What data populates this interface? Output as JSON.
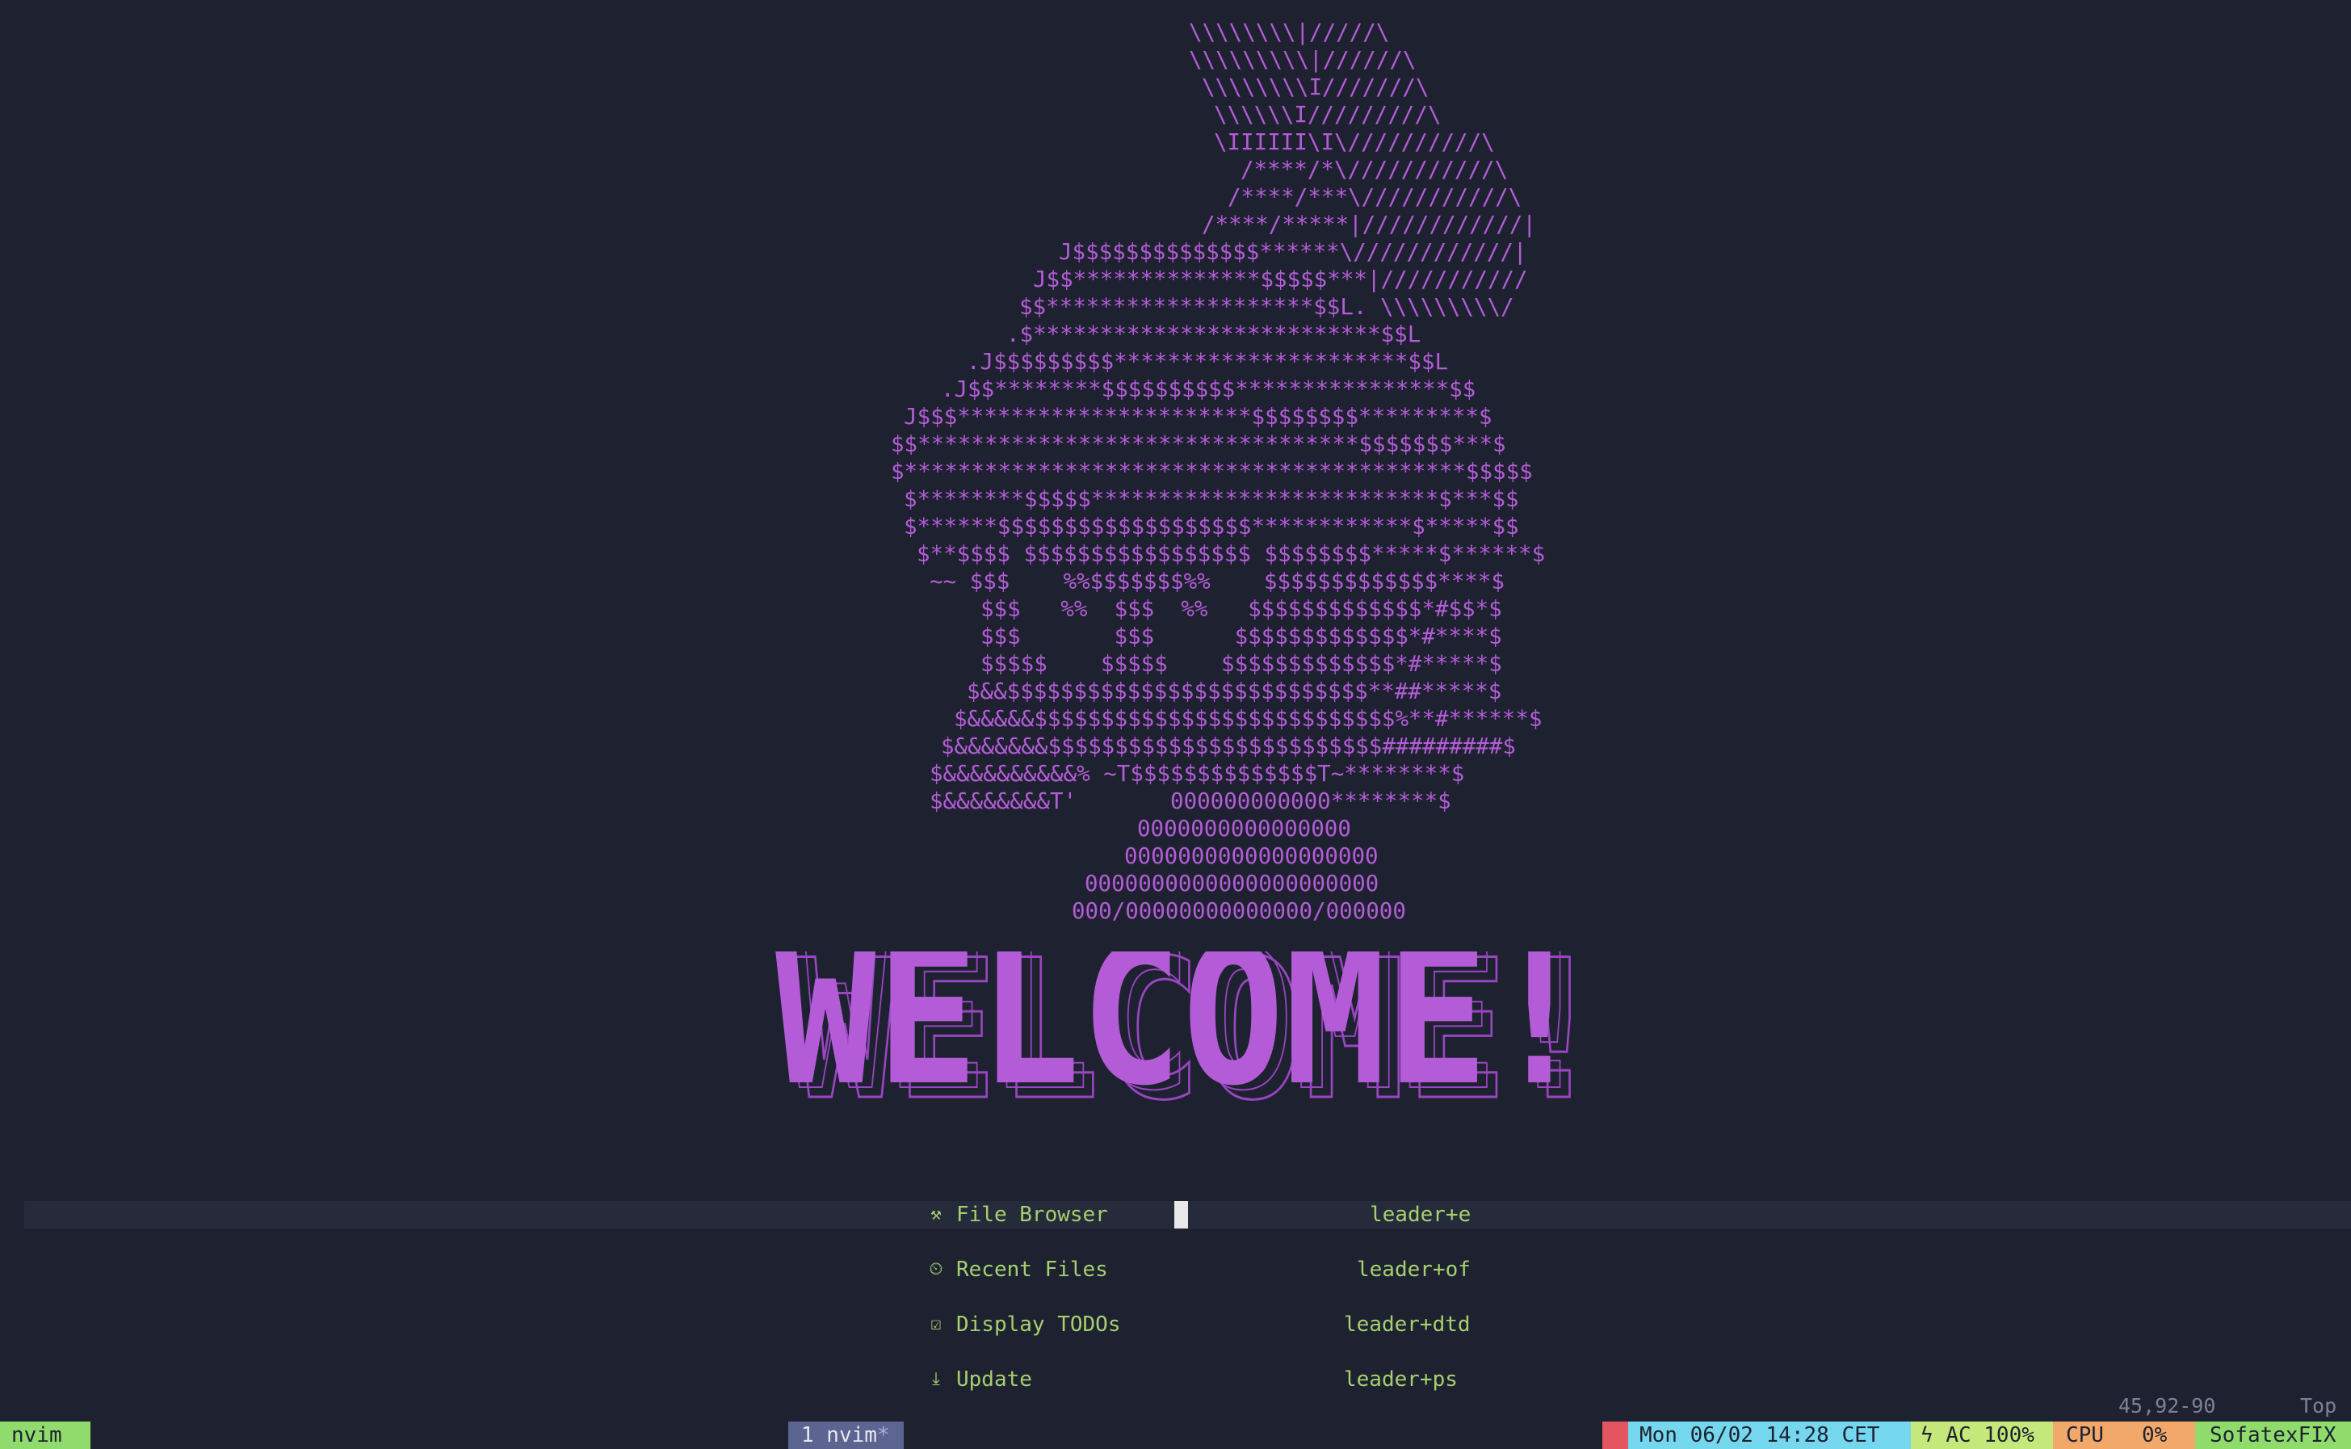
{
  "ascii_art": {
    "color": "#b45cd8",
    "lines": [
      "\\\\\\\\\\\\\\\\|/////\\",
      "\\\\\\\\\\\\\\\\\\|//////\\",
      "\\\\\\\\\\\\\\\\I///////\\",
      "\\\\\\\\\\\\I/////////\\",
      "\\IIIIII\\I\\//////////\\",
      "/****/*\\///////////\\",
      "/****/***\\///////////\\",
      "/****/*****|////////////|",
      "J$$$$$$$$$$$$$$******\\////////////|",
      "J$$**************$$$$$***|///////////",
      "$$********************$$L. \\\\\\\\\\\\\\\\\\/",
      ".$**************************$$L",
      ".J$$$$$$$$$**********************$$L",
      ".J$$********$$$$$$$$$$****************$$",
      "J$$$**********************$$$$$$$$*********$",
      "$$*********************************$$$$$$$***$",
      "$******************************************$$$$$",
      "$********$$$$$**************************$***$$",
      "$******$$$$$$$$$$$$$$$$$$$************$*****$$",
      "$**$$$$ $$$$$$$$$$$$$$$$$ $$$$$$$$*****$******$",
      "~~ $$$    %%$$$$$$$%%    $$$$$$$$$$$$$****$",
      "$$$   %%  $$$  %%   $$$$$$$$$$$$$*#$$*$",
      "$$$       $$$      $$$$$$$$$$$$$*#****$",
      "$$$$$    $$$$$    $$$$$$$$$$$$$*#*****$",
      "$&&$$$$$$$$$$$$$$$$$$$$$$$$$$$**##*****$",
      "$&&&&&$$$$$$$$$$$$$$$$$$$$$$$$$$$%**#******$",
      "$&&&&&&&$$$$$$$$$$$$$$$$$$$$$$$$$#########$",
      "$&&&&&&&&&&% ~T$$$$$$$$$$$$$$T~********$",
      "$&&&&&&&&T'       000000000000********$",
      "0000000000000000",
      "0000000000000000000",
      "0000000000000000000000",
      "000/00000000000000/000000"
    ]
  },
  "banner": {
    "text": "WELCOME!",
    "fill_color": "#b45cd8",
    "outline_color": "#9a45c2"
  },
  "menu": {
    "text_color": "#a6cf6f",
    "items": [
      {
        "icon": "file-browser-icon",
        "glyph": "⚒",
        "label": "File Browser",
        "key": "leader+e"
      },
      {
        "icon": "recent-files-icon",
        "glyph": "⏲",
        "label": "Recent Files",
        "key": "leader+of"
      },
      {
        "icon": "todo-check-icon",
        "glyph": "☑",
        "label": "Display TODOs",
        "key": "leader+dtd"
      },
      {
        "icon": "update-download-icon",
        "glyph": "⤓",
        "label": "Update",
        "key": "leader+ps"
      }
    ]
  },
  "ruler": {
    "position": "45,92-90",
    "scroll": "Top"
  },
  "statusbar": {
    "session_name": "nvim",
    "window_tab": "1 nvim",
    "window_flag": "*",
    "datetime": "Mon 06/02 14:28 CET",
    "power_icon": "ϟ",
    "power": "AC 100%",
    "cpu_label": "CPU",
    "cpu_value": "0%",
    "host": "SofatexFIX",
    "colors": {
      "session_bg": "#8fdc6c",
      "tab_bg": "#5c6591",
      "alert_bg": "#e55561",
      "datetime_bg": "#74d7ee",
      "power_bg": "#c4e87a",
      "cpu_bg": "#f2a86a",
      "host_bg": "#8fdc6c"
    }
  }
}
